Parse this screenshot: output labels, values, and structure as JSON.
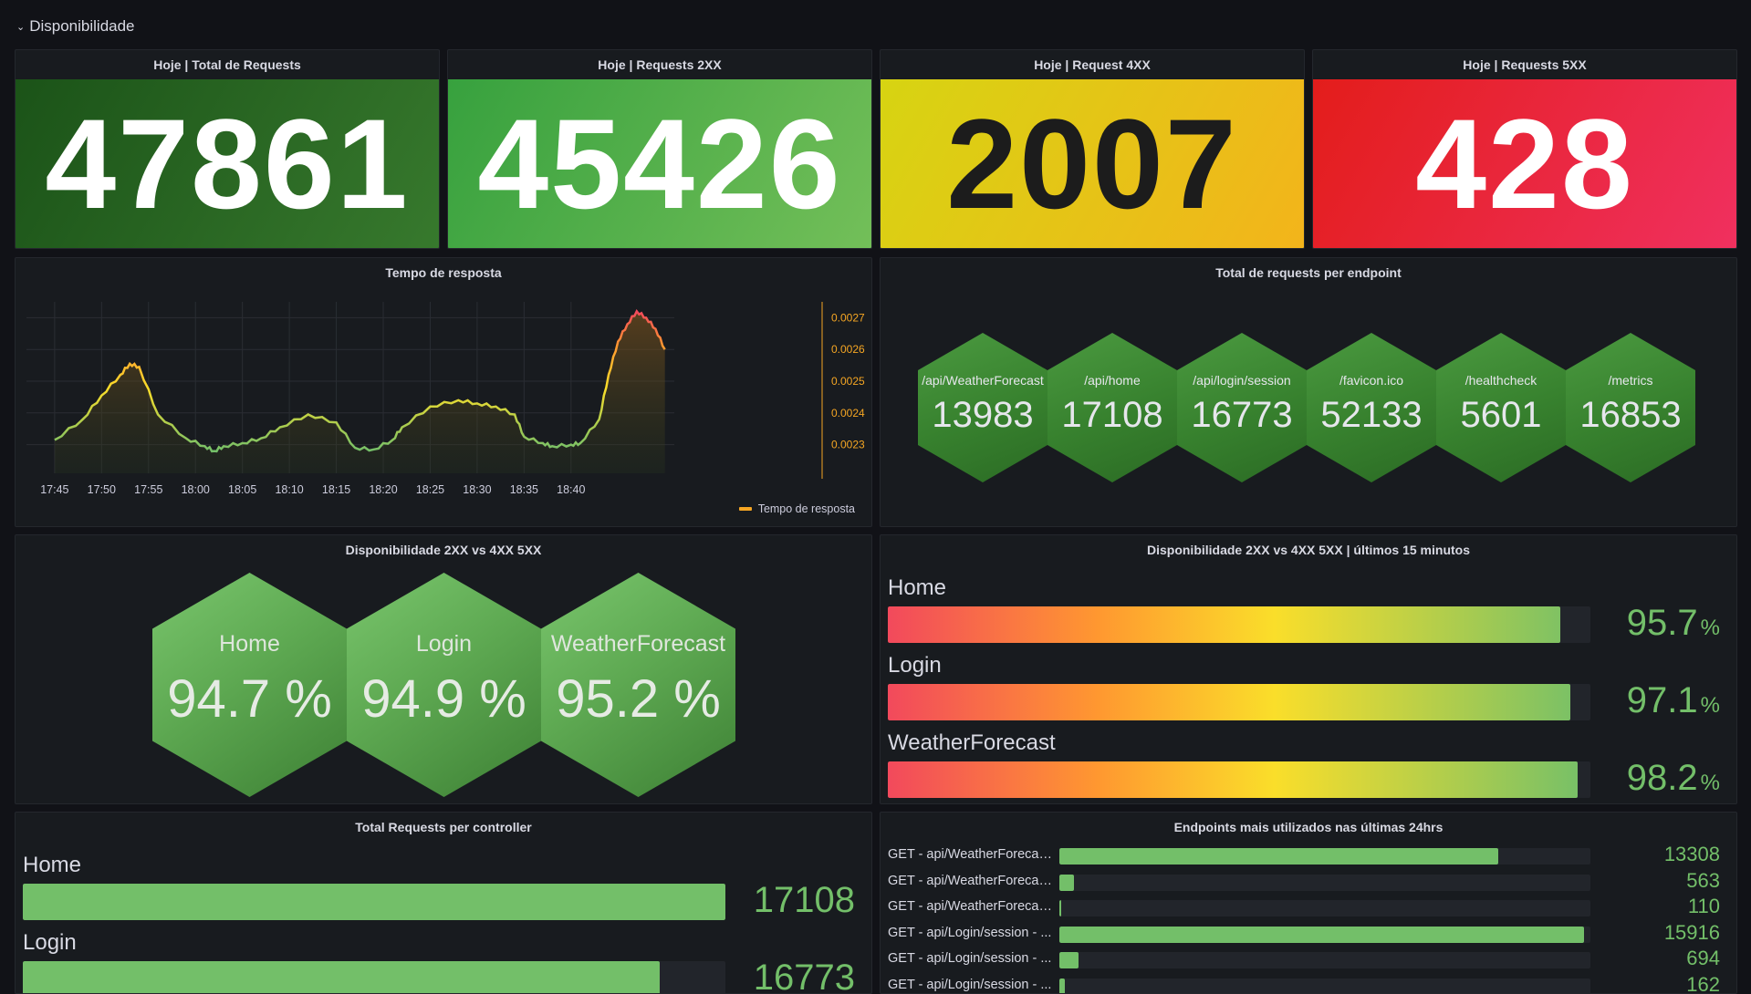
{
  "row": {
    "chevron": "⌄",
    "title": "Disponibilidade"
  },
  "stats": [
    {
      "title": "Hoje | Total de Requests",
      "value": "47861"
    },
    {
      "title": "Hoje | Requests 2XX",
      "value": "45426"
    },
    {
      "title": "Hoje | Request 4XX",
      "value": "2007"
    },
    {
      "title": "Hoje | Requests 5XX",
      "value": "428"
    }
  ],
  "colors": {
    "green": "#73bf69",
    "dark_green": "#2d6a25",
    "yellow": "#e5b50e",
    "red": "#e02f44"
  },
  "response_time": {
    "title": "Tempo de resposta",
    "legend": "Tempo de resposta",
    "chart_data": {
      "type": "line",
      "x_ticks": [
        "17:45",
        "17:50",
        "17:55",
        "18:00",
        "18:05",
        "18:10",
        "18:15",
        "18:20",
        "18:25",
        "18:30",
        "18:35",
        "18:40"
      ],
      "y_ticks": [
        "0.0023",
        "0.0024",
        "0.0025",
        "0.0026",
        "0.0027"
      ],
      "ylim": [
        0.00225,
        0.00275
      ],
      "x_minutes": [
        0,
        3,
        5,
        7,
        8,
        9,
        11,
        14,
        16,
        17,
        18,
        20,
        22,
        24,
        27,
        30,
        32,
        34,
        36,
        37,
        40,
        43,
        45,
        47,
        49,
        50,
        52,
        53,
        55,
        56,
        58,
        59,
        60,
        61,
        62,
        63,
        64,
        65
      ],
      "values": [
        0.002315,
        0.00238,
        0.002455,
        0.00252,
        0.002555,
        0.002545,
        0.002395,
        0.00232,
        0.002295,
        0.00228,
        0.002295,
        0.002305,
        0.00232,
        0.002355,
        0.002395,
        0.00237,
        0.00229,
        0.002285,
        0.002315,
        0.002355,
        0.00242,
        0.00244,
        0.00243,
        0.00242,
        0.002395,
        0.002325,
        0.002305,
        0.002295,
        0.0023,
        0.002305,
        0.00238,
        0.00252,
        0.002625,
        0.00268,
        0.00272,
        0.0027,
        0.002665,
        0.0026
      ],
      "series": [
        {
          "name": "Tempo de resposta",
          "color": "#f5a623"
        }
      ]
    }
  },
  "endpoints_total": {
    "title": "Total de requests per endpoint",
    "items": [
      {
        "label": "/api/WeatherForecast",
        "value": "13983"
      },
      {
        "label": "/api/home",
        "value": "17108"
      },
      {
        "label": "/api/login/session",
        "value": "16773"
      },
      {
        "label": "/favicon.ico",
        "value": "52133"
      },
      {
        "label": "/healthcheck",
        "value": "5601"
      },
      {
        "label": "/metrics",
        "value": "16853"
      }
    ]
  },
  "availability": {
    "title": "Disponibilidade 2XX vs 4XX 5XX",
    "items": [
      {
        "label": "Home",
        "value": "94.7 %"
      },
      {
        "label": "Login",
        "value": "94.9 %"
      },
      {
        "label": "WeatherForecast",
        "value": "95.2 %"
      }
    ]
  },
  "availability_15m": {
    "title": "Disponibilidade 2XX vs 4XX 5XX | últimos 15 minutos",
    "unit": "%",
    "items": [
      {
        "label": "Home",
        "value": "95.7",
        "fraction": 0.957
      },
      {
        "label": "Login",
        "value": "97.1",
        "fraction": 0.971
      },
      {
        "label": "WeatherForecast",
        "value": "98.2",
        "fraction": 0.982
      }
    ]
  },
  "controllers": {
    "title": "Total Requests per controller",
    "items": [
      {
        "label": "Home",
        "value": "17108",
        "fraction": 1.0
      },
      {
        "label": "Login",
        "value": "16773",
        "fraction": 0.906
      }
    ]
  },
  "top_endpoints": {
    "title": "Endpoints mais utilizados nas últimas 24hrs",
    "items": [
      {
        "label": "GET - api/WeatherForecas...",
        "value": "13308",
        "fraction": 0.826
      },
      {
        "label": "GET - api/WeatherForecas...",
        "value": "563",
        "fraction": 0.027
      },
      {
        "label": "GET - api/WeatherForecas...",
        "value": "110",
        "fraction": 0.004
      },
      {
        "label": "GET - api/Login/session - ...",
        "value": "15916",
        "fraction": 0.988
      },
      {
        "label": "GET - api/Login/session - ...",
        "value": "694",
        "fraction": 0.036
      },
      {
        "label": "GET - api/Login/session - ...",
        "value": "162",
        "fraction": 0.01
      }
    ]
  }
}
